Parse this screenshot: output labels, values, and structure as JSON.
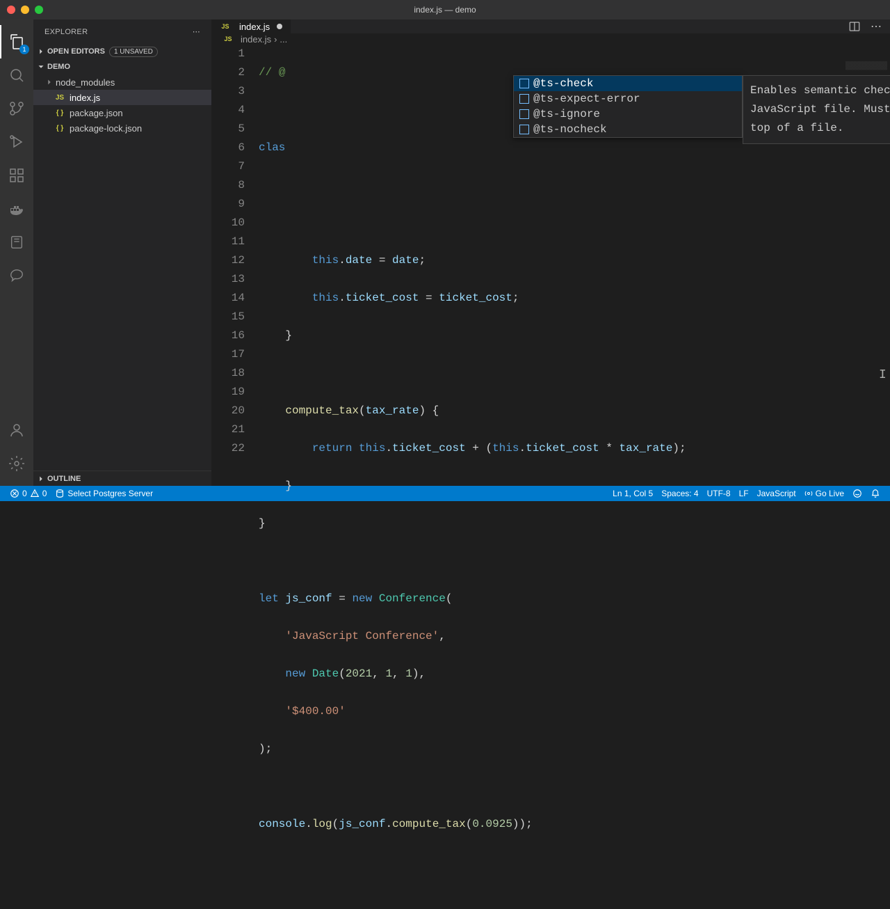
{
  "window": {
    "title": "index.js — demo"
  },
  "explorer": {
    "title": "EXPLORER",
    "openEditors": "OPEN EDITORS",
    "unsaved": "1 UNSAVED",
    "project": "DEMO",
    "outline": "OUTLINE",
    "items": [
      {
        "label": "node_modules",
        "kind": "folder"
      },
      {
        "label": "index.js",
        "kind": "js",
        "active": true
      },
      {
        "label": "package.json",
        "kind": "json"
      },
      {
        "label": "package-lock.json",
        "kind": "json"
      }
    ]
  },
  "activityBadge": "1",
  "tab": {
    "label": "index.js"
  },
  "breadcrumb": {
    "file": "index.js",
    "sep": "›",
    "rest": "..."
  },
  "lineNumbers": [
    "1",
    "2",
    "3",
    "4",
    "5",
    "6",
    "7",
    "8",
    "9",
    "10",
    "11",
    "12",
    "13",
    "14",
    "15",
    "16",
    "17",
    "18",
    "19",
    "20",
    "21",
    "22"
  ],
  "code": {
    "l1a": "// ",
    "l1b": "@",
    "l3": "clas",
    "l6_this": "this",
    "l6_dot": ".",
    "l6_prop": "date",
    "l6_eq": " = ",
    "l6_rhs": "date",
    "l6_end": ";",
    "l7_this": "this",
    "l7_prop": "ticket_cost",
    "l7_rhs": "ticket_cost",
    "l10_fn": "compute_tax",
    "l10_param": "tax_rate",
    "l11_ret": "return ",
    "l11_this": "this",
    "l11_prop": "ticket_cost",
    "l11_plus": " + (",
    "l11_this2": "this",
    "l11_prop2": "ticket_cost",
    "l11_mul": " * ",
    "l11_rhs": "tax_rate",
    "l11_end": ");",
    "l15_let": "let ",
    "l15_var": "js_conf",
    "l15_eq": " = ",
    "l15_new": "new ",
    "l15_type": "Conference",
    "l15_open": "(",
    "l16_str": "'JavaScript Conference'",
    "l16_comma": ",",
    "l17_new": "new ",
    "l17_type": "Date",
    "l17_args_open": "(",
    "l17_n1": "2021",
    "l17_c": ", ",
    "l17_n2": "1",
    "l17_n3": "1",
    "l17_close": "),",
    "l18_str": "'$400.00'",
    "l19": ");",
    "l21a": "console",
    "l21b": "log",
    "l21c": "js_conf",
    "l21d": "compute_tax",
    "l21n": "0.0925"
  },
  "suggest": {
    "items": [
      "@ts-check",
      "@ts-expect-error",
      "@ts-ignore",
      "@ts-nocheck"
    ],
    "doc": "Enables semantic checking in a JavaScript file. Must be at the top of a file."
  },
  "status": {
    "errors": "0",
    "warnings": "0",
    "postgres": "Select Postgres Server",
    "pos": "Ln 1, Col 5",
    "spaces": "Spaces: 4",
    "encoding": "UTF-8",
    "eol": "LF",
    "lang": "JavaScript",
    "golive": "Go Live"
  }
}
